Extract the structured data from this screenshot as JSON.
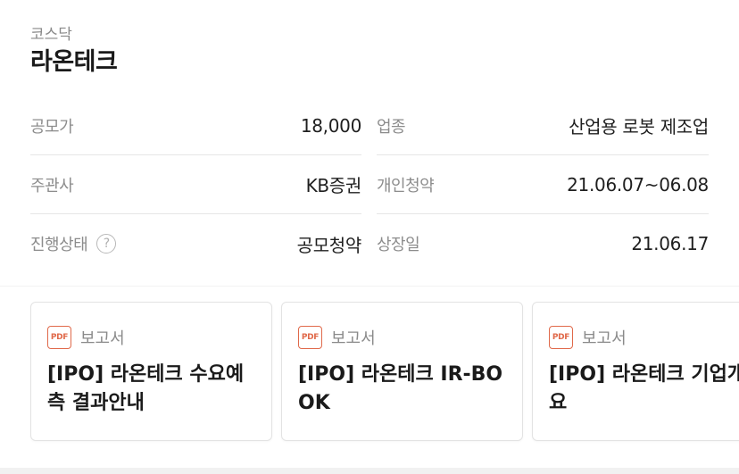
{
  "header": {
    "market": "코스닥",
    "company": "라온테크"
  },
  "info": {
    "offer_price_label": "공모가",
    "offer_price_value": "18,000",
    "industry_label": "업종",
    "industry_value": "산업용 로봇 제조업",
    "underwriter_label": "주관사",
    "underwriter_value": "KB증권",
    "retail_subscription_label": "개인청약",
    "retail_subscription_value": "21.06.07~06.08",
    "status_label": "진행상태",
    "status_help": "?",
    "status_value": "공모청약",
    "listing_date_label": "상장일",
    "listing_date_value": "21.06.17"
  },
  "cards": [
    {
      "icon": "PDF",
      "type": "보고서",
      "title": "[IPO] 라온테크 수요예측 결과안내"
    },
    {
      "icon": "PDF",
      "type": "보고서",
      "title": "[IPO] 라온테크 IR-BOOK"
    },
    {
      "icon": "PDF",
      "type": "보고서",
      "title": "[IPO] 라온테크 기업개요"
    }
  ],
  "colors": {
    "pdf_accent": "#e0694a",
    "label_gray": "#8c8c8c",
    "divider": "#e6e6e6"
  }
}
